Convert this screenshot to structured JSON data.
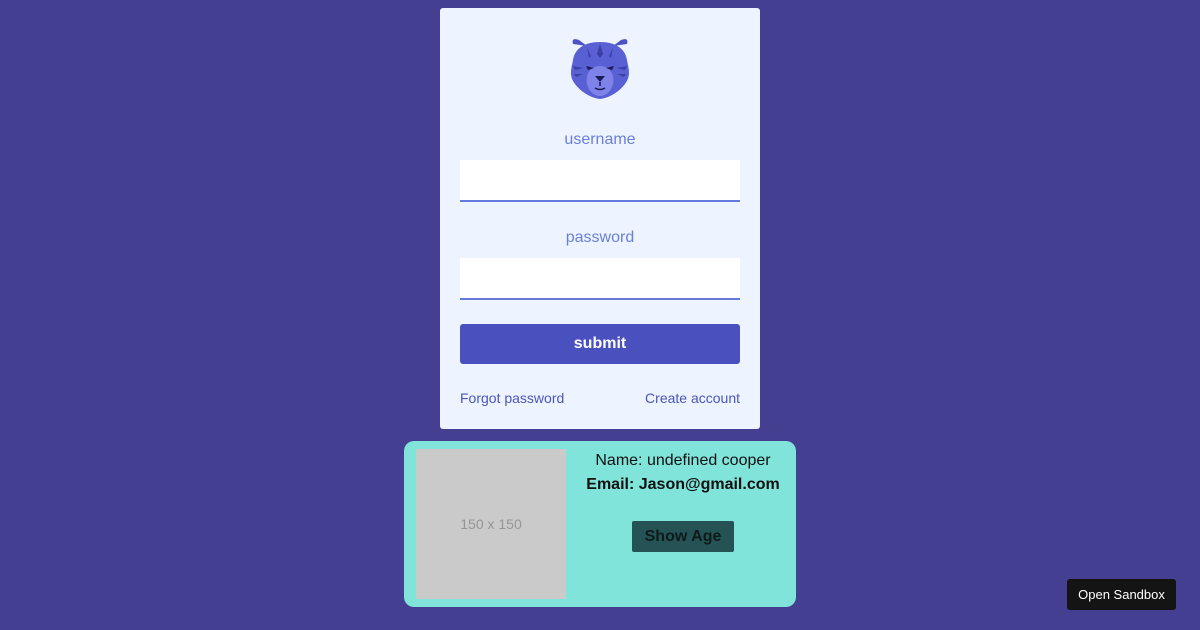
{
  "login": {
    "logo_icon": "tiger-head-icon",
    "username_label": "username",
    "username_value": "",
    "password_label": "password",
    "password_value": "",
    "submit_label": "submit",
    "forgot_password_label": "Forgot password",
    "create_account_label": "Create account"
  },
  "profile": {
    "image_placeholder": "150 x 150",
    "name_text": "Name: undefined cooper",
    "email_text": "Email: Jason@gmail.com",
    "show_age_label": "Show Age"
  },
  "sandbox": {
    "open_label": "Open Sandbox"
  },
  "colors": {
    "page_background": "#453f91",
    "card_background": "#edf4ff",
    "accent": "#4b50bf",
    "profile_background": "#80e4da",
    "show_age_button": "#255355"
  }
}
